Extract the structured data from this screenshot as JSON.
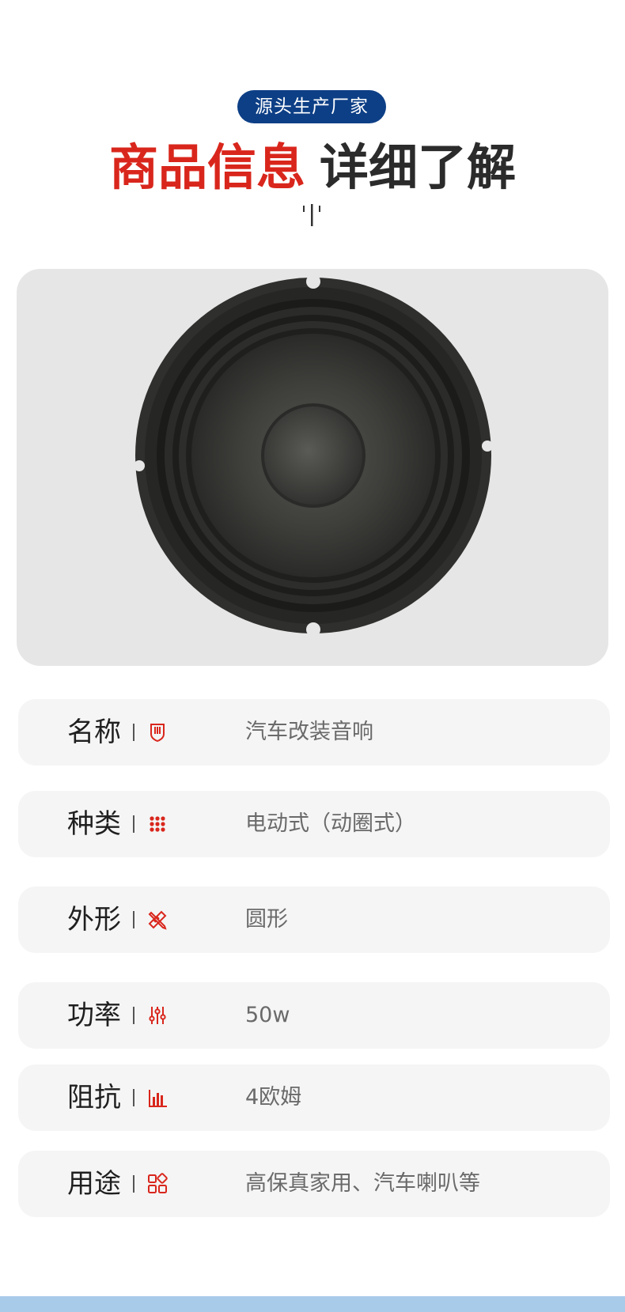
{
  "header": {
    "badge": "源头生产厂家",
    "title_highlight": "商品信息",
    "title_rest": "详细了解"
  },
  "colors": {
    "accent_red": "#d9261c",
    "badge_blue": "#0d3f86",
    "row_background": "#f5f5f5",
    "bottom_bar": "#a9cbea"
  },
  "product_image": {
    "subject": "speaker-driver"
  },
  "specs": [
    {
      "label": "名称",
      "icon": "shield-icon",
      "value": "汽车改装音响"
    },
    {
      "label": "种类",
      "icon": "dot-grid-icon",
      "value": "电动式（动圈式）"
    },
    {
      "label": "外形",
      "icon": "ruler-pencil-icon",
      "value": "圆形"
    },
    {
      "label": "功率",
      "icon": "sliders-icon",
      "value": "50w"
    },
    {
      "label": "阻抗",
      "icon": "bar-chart-icon",
      "value": "4欧姆"
    },
    {
      "label": "用途",
      "icon": "apps-grid-icon",
      "value": "高保真家用、汽车喇叭等"
    }
  ]
}
